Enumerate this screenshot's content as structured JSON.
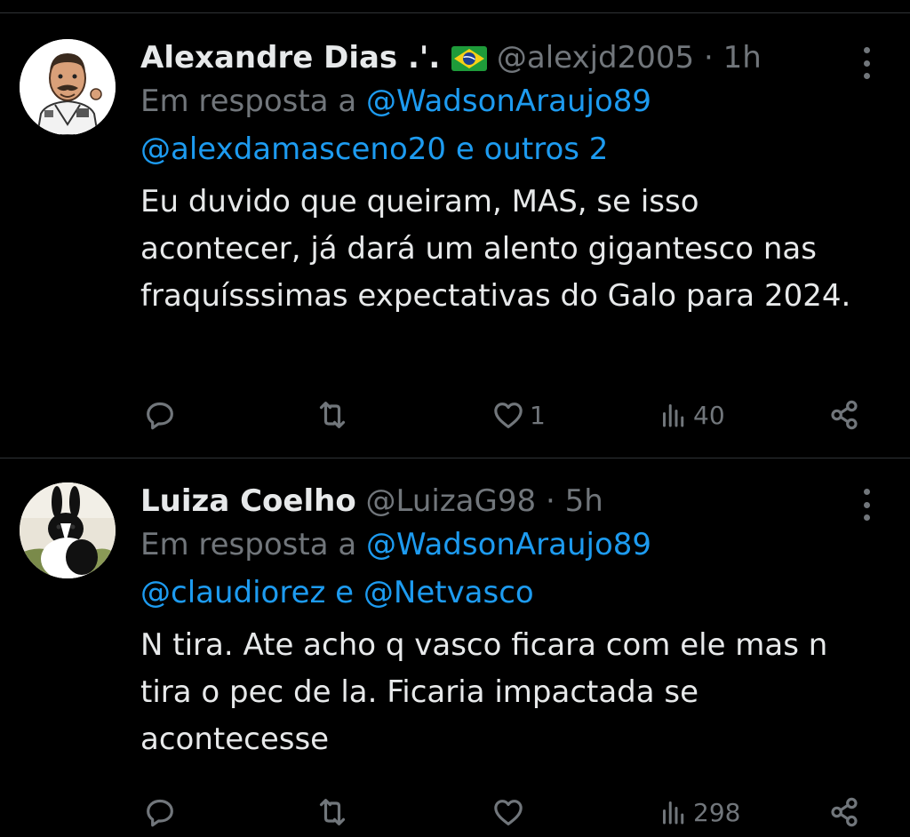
{
  "tweets": [
    {
      "name": "Alexandre Dias .'.",
      "handle": "@alexjd2005",
      "separator": "·",
      "time": "1h",
      "reply_prefix": "Em resposta a",
      "reply_first_mention": "@WadsonAraujo89",
      "reply_second_line": "@alexdamasceno20 e outros 2",
      "text": "Eu duvido que queiram, MAS, se isso acontecer, já dará um alento gigantesco nas fraquísssimas expectativas do Galo para 2024.",
      "likes": "1",
      "views": "40"
    },
    {
      "name": "Luiza Coelho",
      "handle": "@LuizaG98",
      "separator": "·",
      "time": "5h",
      "reply_prefix": "Em resposta a",
      "reply_first_mention": "@WadsonAraujo89",
      "reply_second_line": "@claudiorez e @Netvasco",
      "text": "N tira. Ate acho q vasco ficara com ele mas n tira o pec de la. Ficaria impactada se acontecesse",
      "likes": "",
      "views": "298"
    }
  ],
  "icons": {
    "reply": "reply-icon",
    "retweet": "retweet-icon",
    "like": "heart-icon",
    "views": "views-icon",
    "share": "share-icon",
    "more": "more-icon",
    "flag": "brazil-flag-icon"
  },
  "colors": {
    "background": "#000000",
    "text": "#e7e9ea",
    "secondary": "#71767b",
    "link": "#1d9bf0",
    "divider": "#2f3336"
  }
}
